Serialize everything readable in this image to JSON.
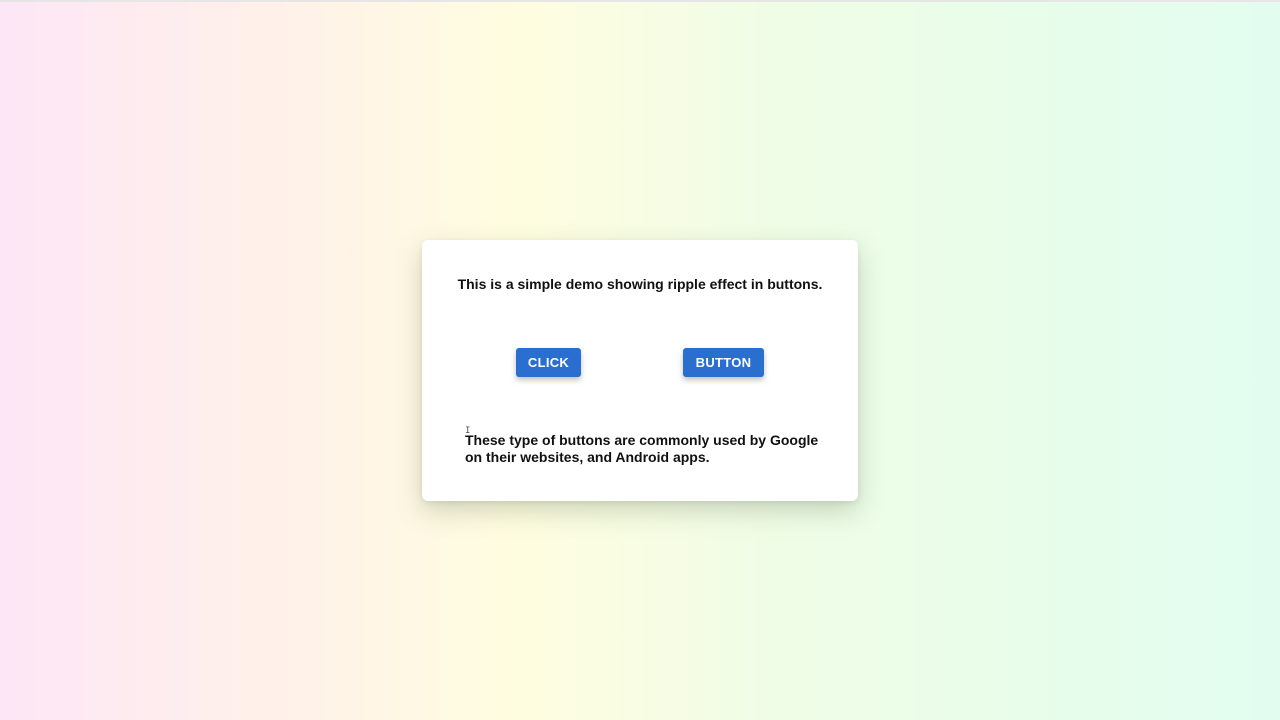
{
  "card": {
    "title": "This is a simple demo showing ripple effect in buttons.",
    "buttons": {
      "click_label": "CLICK",
      "button_label": "BUTTON"
    },
    "description": "These type of buttons are commonly used by Google on their websites, and Android apps."
  },
  "colors": {
    "button_bg": "#2a6fcf",
    "button_text": "#ffffff",
    "card_bg": "#ffffff"
  },
  "icons": {
    "cursor": "text-cursor-icon"
  }
}
